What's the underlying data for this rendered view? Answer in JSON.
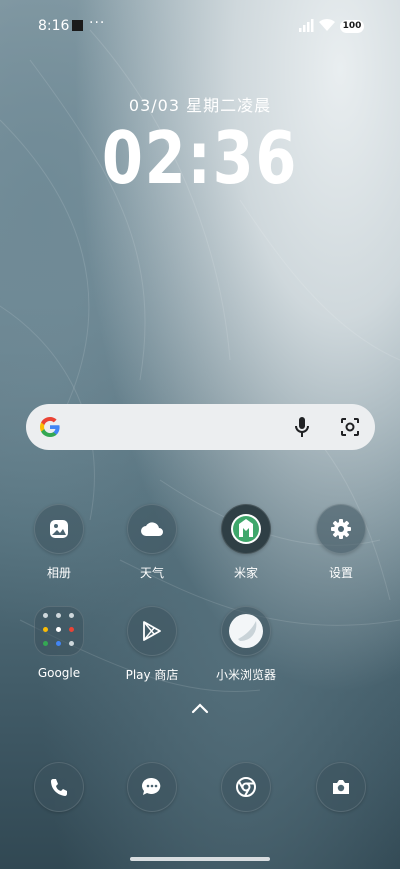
{
  "status_bar": {
    "time": "8:16",
    "notification_dots": "···",
    "battery": "100"
  },
  "lockscreen": {
    "date": "03/03  星期二凌晨",
    "time": "02:36"
  },
  "search_bar": {
    "provider_icon": "google-g-icon",
    "mic_icon": "microphone-icon",
    "lens_icon": "google-lens-icon"
  },
  "apps_row1": [
    {
      "label": "相册",
      "icon": "photos-icon"
    },
    {
      "label": "天气",
      "icon": "weather-icon"
    },
    {
      "label": "米家",
      "icon": "mijia-icon"
    },
    {
      "label": "设置",
      "icon": "settings-icon"
    }
  ],
  "apps_row2": [
    {
      "label": "Google",
      "icon": "google-folder-icon"
    },
    {
      "label": "Play 商店",
      "icon": "play-store-icon"
    },
    {
      "label": "小米浏览器",
      "icon": "mi-browser-icon"
    }
  ],
  "dock": [
    {
      "icon": "phone-icon"
    },
    {
      "icon": "messages-icon"
    },
    {
      "icon": "chrome-icon"
    },
    {
      "icon": "camera-icon"
    }
  ],
  "colors": {
    "accent_green": "#3fa76b",
    "search_bg": "#eceef0"
  }
}
